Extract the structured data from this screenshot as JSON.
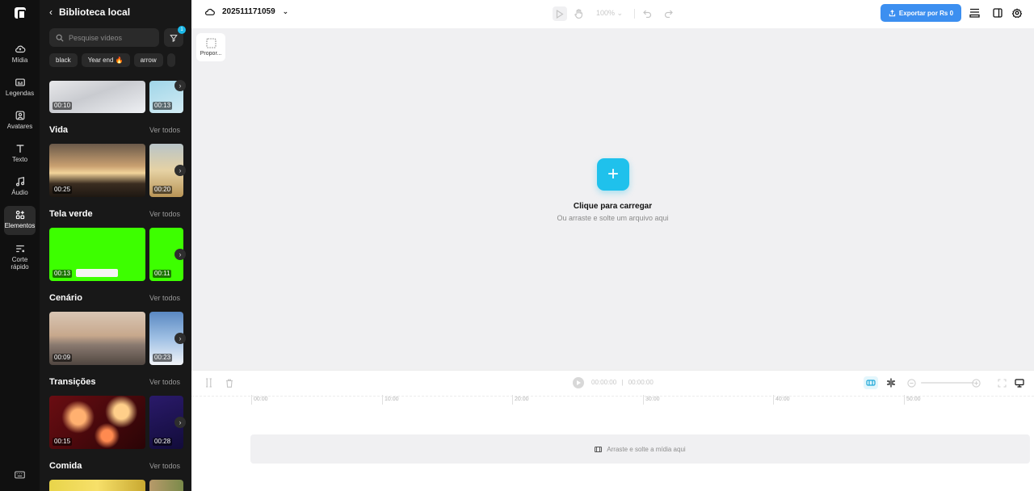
{
  "rail": {
    "items": [
      {
        "label": "Mídia",
        "icon": "cloud-upload-icon"
      },
      {
        "label": "Legendas",
        "icon": "captions-icon"
      },
      {
        "label": "Avatares",
        "icon": "avatar-icon"
      },
      {
        "label": "Texto",
        "icon": "text-icon"
      },
      {
        "label": "Áudio",
        "icon": "music-icon"
      },
      {
        "label": "Elementos",
        "icon": "elements-icon"
      },
      {
        "label": "Corte rápido",
        "icon": "scissors-icon"
      }
    ],
    "active": "Elementos"
  },
  "library": {
    "title": "Biblioteca local",
    "search_placeholder": "Pesquise vídeos",
    "filter_badge": "1",
    "chips": [
      "black",
      "Year end 🔥",
      "arrow"
    ],
    "see_all": "Ver todos",
    "top_durations": [
      "00:10",
      "00:13"
    ],
    "sections": [
      {
        "title": "Vida",
        "durations": [
          "00:25",
          "00:20"
        ]
      },
      {
        "title": "Tela verde",
        "durations": [
          "00:13",
          "00:11"
        ]
      },
      {
        "title": "Cenário",
        "durations": [
          "00:09",
          "00:23"
        ]
      },
      {
        "title": "Transições",
        "durations": [
          "00:15",
          "00:28"
        ]
      },
      {
        "title": "Comida",
        "durations": []
      }
    ]
  },
  "topbar": {
    "project_name": "202511171059",
    "zoom": "100%",
    "export_label": "Exportar por Rs 0"
  },
  "canvas": {
    "ratio_label": "Propor...",
    "upload_title": "Clique para carregar",
    "upload_subtitle": "Ou arraste e solte um arquivo aqui"
  },
  "timeline": {
    "current_time": "00:00:00",
    "separator": "|",
    "total_time": "00:00:00",
    "ruler": [
      "00:00",
      "10:00",
      "20:00",
      "30:00",
      "40:00",
      "50:00"
    ],
    "drop_label": "Arraste e solte a mídia aqui"
  },
  "colors": {
    "accent": "#1fc1ec",
    "export": "#3c8ff0",
    "green_screen": "#3dff00"
  }
}
